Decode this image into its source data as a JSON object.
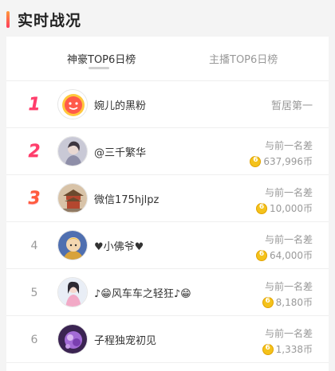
{
  "header": {
    "title": "实时战况"
  },
  "tabs": [
    {
      "label": "神豪TOP6日榜",
      "active": true
    },
    {
      "label": "主播TOP6日榜",
      "active": false
    }
  ],
  "rows": [
    {
      "rank": "1",
      "name": "婉儿的黑粉",
      "status": "暂居第一"
    },
    {
      "rank": "2",
      "name": "@三千繁华",
      "diff_label": "与前一名差",
      "diff_amount": "637,996币"
    },
    {
      "rank": "3",
      "name": "微信175hjlpz",
      "diff_label": "与前一名差",
      "diff_amount": "10,000币"
    },
    {
      "rank": "4",
      "name": "♥小佛爷♥",
      "diff_label": "与前一名差",
      "diff_amount": "64,000币"
    },
    {
      "rank": "5",
      "name": "♪😁风车车之轻狂♪😁",
      "diff_label": "与前一名差",
      "diff_amount": "8,180币"
    },
    {
      "rank": "6",
      "name": "子程独宠初见",
      "diff_label": "与前一名差",
      "diff_amount": "1,338币"
    }
  ],
  "colors": {
    "rank_top": "#ff3d6b",
    "coin": "#f4c21b",
    "accent_gradient": [
      "#ff9a3c",
      "#ff3b5c"
    ]
  }
}
